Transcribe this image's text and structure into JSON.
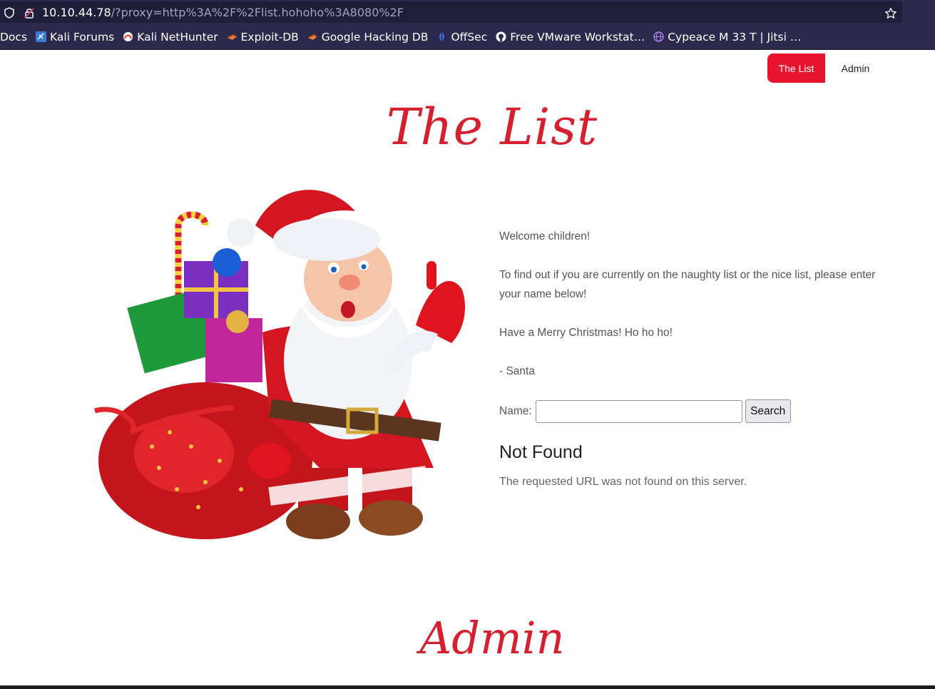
{
  "browser": {
    "url_host": "10.10.44.78",
    "url_path": "/?proxy=http%3A%2F%2Flist.hohoho%3A8080%2F",
    "icons": {
      "shield": "shield-icon",
      "lock": "lock-icon",
      "star": "star-icon"
    }
  },
  "bookmarks": [
    {
      "label": "Docs",
      "icon": ""
    },
    {
      "label": "Kali Forums",
      "icon": "kali-forums-icon",
      "color": "#3b7bd8"
    },
    {
      "label": "Kali NetHunter",
      "icon": "kali-nethunter-icon",
      "color": "#e53935"
    },
    {
      "label": "Exploit-DB",
      "icon": "exploit-db-icon",
      "color": "#f07b2a"
    },
    {
      "label": "Google Hacking DB",
      "icon": "ghdb-icon",
      "color": "#f07b2a"
    },
    {
      "label": "OffSec",
      "icon": "offsec-icon",
      "color": "#3a6fd8"
    },
    {
      "label": "Free VMware Workstat…",
      "icon": "github-icon",
      "color": "#ffffff"
    },
    {
      "label": "Cypeace M 33 T | Jitsi …",
      "icon": "globe-icon",
      "color": "#b58cff"
    }
  ],
  "nav": {
    "active_label": "The List",
    "admin_label": "Admin"
  },
  "page": {
    "title": "The List",
    "paragraphs": [
      "Welcome children!",
      "To find out if you are currently on the naughty list or the nice list, please enter your name below!",
      "Have a Merry Christmas! Ho ho ho!",
      "- Santa"
    ],
    "form": {
      "label": "Name:",
      "input_value": "",
      "button_label": "Search"
    },
    "result": {
      "title": "Not Found",
      "message": "The requested URL was not found on this server."
    },
    "admin_title": "Admin"
  },
  "colors": {
    "accent": "#e8142d",
    "title_red": "#d6202f",
    "chrome_bg": "#2b2a4c"
  }
}
